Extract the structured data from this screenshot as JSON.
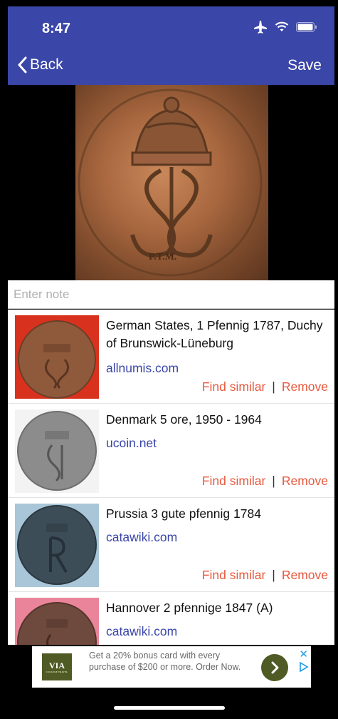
{
  "status": {
    "time": "8:47"
  },
  "nav": {
    "back_label": "Back",
    "save_label": "Save"
  },
  "note": {
    "placeholder": "Enter note",
    "value": ""
  },
  "results": [
    {
      "title": "German States, 1 Pfennig 1787, Duchy of Brunswick-Lüneburg",
      "source": "allnumis.com",
      "find_similar": "Find similar",
      "remove": "Remove"
    },
    {
      "title": "Denmark 5 ore, 1950 - 1964",
      "source": "ucoin.net",
      "find_similar": "Find similar",
      "remove": "Remove"
    },
    {
      "title": "Prussia 3 gute pfennig 1784",
      "source": "catawiki.com",
      "find_similar": "Find similar",
      "remove": "Remove"
    },
    {
      "title": "Hannover 2 pfennige 1847 (A)",
      "source": "catawiki.com"
    }
  ],
  "ad": {
    "logo_text": "VIA",
    "logo_subtext": "COLLEGE TRAVEL",
    "text": "Get a 20% bonus card with every purchase of $200 or more. Order Now."
  },
  "colors": {
    "header": "#3A46A8",
    "link": "#3A46A8",
    "action": "#E8583D",
    "ad_accent": "#4f5a24"
  }
}
